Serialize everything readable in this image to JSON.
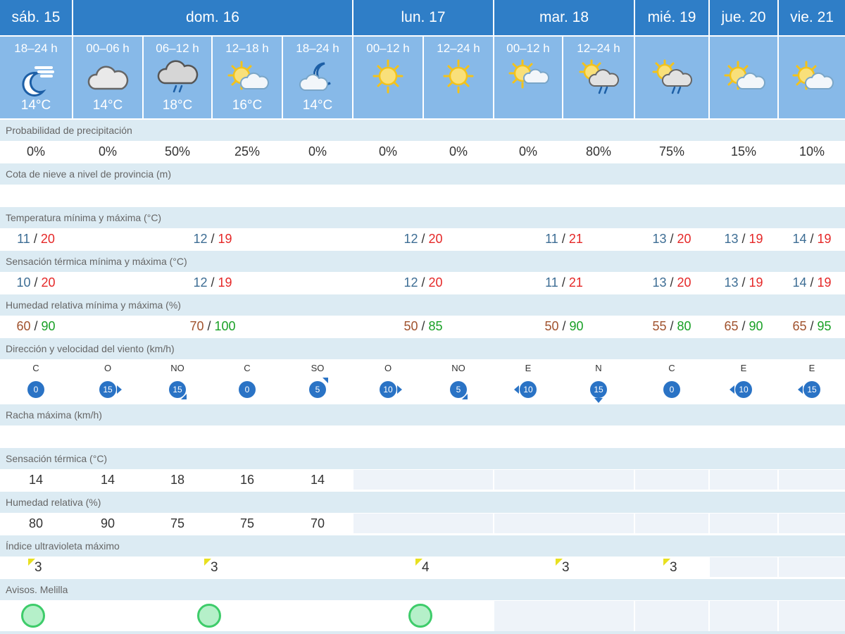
{
  "days": [
    "sáb. 15",
    "dom. 16",
    "lun. 17",
    "mar. 18",
    "mié. 19",
    "jue. 20",
    "vie. 21"
  ],
  "periods": [
    {
      "time": "18–24 h",
      "temp": "14°C",
      "icon": "moon-clouds-icon"
    },
    {
      "time": "00–06 h",
      "temp": "14°C",
      "icon": "cloud-icon"
    },
    {
      "time": "06–12 h",
      "temp": "18°C",
      "icon": "cloud-rain-icon"
    },
    {
      "time": "12–18 h",
      "temp": "16°C",
      "icon": "sun-cloud-icon"
    },
    {
      "time": "18–24 h",
      "temp": "14°C",
      "icon": "moon-cloud-icon"
    },
    {
      "time": "00–12 h",
      "temp": "",
      "icon": "sun-icon"
    },
    {
      "time": "12–24 h",
      "temp": "",
      "icon": "sun-icon"
    },
    {
      "time": "00–12 h",
      "temp": "",
      "icon": "sun-cloud-icon"
    },
    {
      "time": "12–24 h",
      "temp": "",
      "icon": "sun-cloud-rain-icon"
    },
    {
      "time": "",
      "temp": "",
      "icon": "sun-cloud-rain-icon"
    },
    {
      "time": "",
      "temp": "",
      "icon": "sun-cloud-icon"
    },
    {
      "time": "",
      "temp": "",
      "icon": "sun-cloud-icon"
    }
  ],
  "labels": {
    "precip": "Probabilidad de precipitación",
    "snow": "Cota de nieve a nivel de provincia (m)",
    "temp": "Temperatura mínima y máxima (°C)",
    "feels": "Sensación térmica mínima y máxima (°C)",
    "hum": "Humedad relativa mínima y máxima (%)",
    "wind": "Dirección y velocidad del viento (km/h)",
    "gust": "Racha máxima (km/h)",
    "feels_p": "Sensación térmica (°C)",
    "hum_p": "Humedad relativa (%)",
    "uv": "Índice ultravioleta máximo",
    "warn": "Avisos. Melilla"
  },
  "precip": [
    "0%",
    "0%",
    "50%",
    "25%",
    "0%",
    "0%",
    "0%",
    "0%",
    "80%",
    "75%",
    "15%",
    "10%"
  ],
  "temp_minmax": [
    {
      "lo": "11",
      "hi": "20"
    },
    {
      "lo": "12",
      "hi": "19"
    },
    {
      "lo": "12",
      "hi": "20"
    },
    {
      "lo": "11",
      "hi": "21"
    },
    {
      "lo": "13",
      "hi": "20"
    },
    {
      "lo": "13",
      "hi": "19"
    },
    {
      "lo": "14",
      "hi": "19"
    }
  ],
  "feels_minmax": [
    {
      "lo": "10",
      "hi": "20"
    },
    {
      "lo": "12",
      "hi": "19"
    },
    {
      "lo": "12",
      "hi": "20"
    },
    {
      "lo": "11",
      "hi": "21"
    },
    {
      "lo": "13",
      "hi": "20"
    },
    {
      "lo": "13",
      "hi": "19"
    },
    {
      "lo": "14",
      "hi": "19"
    }
  ],
  "hum_minmax": [
    {
      "lo": "60",
      "hi": "90"
    },
    {
      "lo": "70",
      "hi": "100"
    },
    {
      "lo": "50",
      "hi": "85"
    },
    {
      "lo": "50",
      "hi": "90"
    },
    {
      "lo": "55",
      "hi": "80"
    },
    {
      "lo": "65",
      "hi": "90"
    },
    {
      "lo": "65",
      "hi": "95"
    }
  ],
  "wind": [
    {
      "dir": "C",
      "speed": "0"
    },
    {
      "dir": "O",
      "speed": "15"
    },
    {
      "dir": "NO",
      "speed": "15"
    },
    {
      "dir": "C",
      "speed": "0"
    },
    {
      "dir": "SO",
      "speed": "5"
    },
    {
      "dir": "O",
      "speed": "10"
    },
    {
      "dir": "NO",
      "speed": "5"
    },
    {
      "dir": "E",
      "speed": "10"
    },
    {
      "dir": "N",
      "speed": "15"
    },
    {
      "dir": "C",
      "speed": "0"
    },
    {
      "dir": "E",
      "speed": "10"
    },
    {
      "dir": "E",
      "speed": "15"
    }
  ],
  "feels_period": [
    "14",
    "14",
    "18",
    "16",
    "14"
  ],
  "hum_period": [
    "80",
    "90",
    "75",
    "75",
    "70"
  ],
  "uv": [
    "3",
    "3",
    "4",
    "3",
    "3"
  ],
  "colors": {
    "day_header": "#2f7ec7",
    "period_header": "#87b9e8",
    "band": "#dcebf3",
    "low": "#3d6d94",
    "high": "#e52828",
    "hum_low": "#a0522d",
    "hum_high": "#18a025",
    "wind": "#2a73c5",
    "warning_green": "#3ecc6a"
  }
}
